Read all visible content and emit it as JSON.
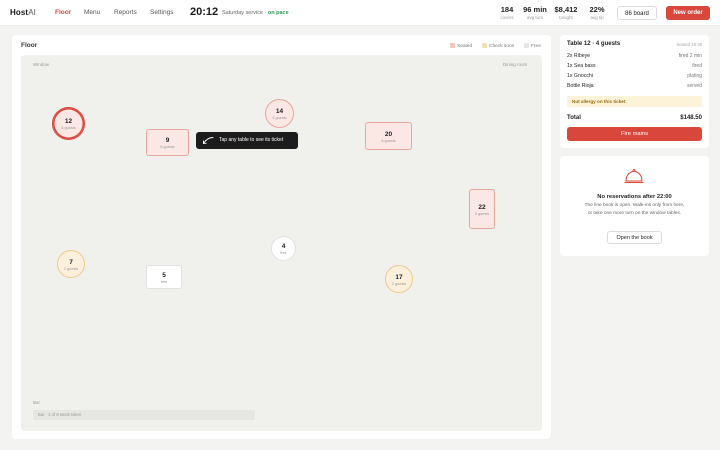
{
  "app": {
    "logo_main": "Host",
    "logo_suffix": "AI"
  },
  "nav": [
    {
      "label": "Floor",
      "active": true
    },
    {
      "label": "Menu",
      "active": false
    },
    {
      "label": "Reports",
      "active": false
    },
    {
      "label": "Settings",
      "active": false
    }
  ],
  "clock": "20:12",
  "service": {
    "label": "Saturday service · ",
    "status": "on pace"
  },
  "stats": [
    {
      "value": "184",
      "label": "covers"
    },
    {
      "value": "96 min",
      "label": "avg turn"
    },
    {
      "value": "$8,412",
      "label": "tonight"
    },
    {
      "value": "22%",
      "label": "avg tip"
    }
  ],
  "buttons": {
    "board": "86 board",
    "new_order": "New order"
  },
  "floor": {
    "title": "Floor",
    "legend": [
      {
        "label": "Seated",
        "color": "#f3c7bf"
      },
      {
        "label": "Check soon",
        "color": "#f4dfb6"
      },
      {
        "label": "Free",
        "color": "#e6e6e6"
      }
    ],
    "zones": {
      "window": "Window",
      "dining": "Dining room",
      "bar": "Bar"
    },
    "bar_status": "Bar · 3 of 8 seats taken",
    "tooltip": "Tap any table to see its ticket",
    "tables": [
      {
        "num": "12",
        "sub": "4 guests",
        "status": "seated",
        "shape": "round",
        "selected": true
      },
      {
        "num": "14",
        "sub": "4 guests",
        "status": "seated",
        "shape": "round"
      },
      {
        "num": "9",
        "sub": "6 guests",
        "status": "seated",
        "shape": "rect"
      },
      {
        "num": "20",
        "sub": "8 guests",
        "status": "seated",
        "shape": "rect"
      },
      {
        "num": "22",
        "sub": "5 guests",
        "status": "seated",
        "shape": "rect"
      },
      {
        "num": "4",
        "sub": "free",
        "status": "free",
        "shape": "round"
      },
      {
        "num": "7",
        "sub": "2 guests",
        "status": "soon",
        "shape": "round"
      },
      {
        "num": "5",
        "sub": "free",
        "status": "free",
        "shape": "rect"
      },
      {
        "num": "17",
        "sub": "2 guests",
        "status": "soon",
        "shape": "round"
      }
    ]
  },
  "ticket": {
    "title": "Table 12 · 4 guests",
    "seated": "Seated 19:36",
    "items": [
      {
        "name": "2x Ribeye",
        "status": "fired 2 min"
      },
      {
        "name": "1x Sea bass",
        "status": "fired"
      },
      {
        "name": "1x Gnocchi",
        "status": "plating"
      },
      {
        "name": "Bottle Rioja",
        "status": "served"
      }
    ],
    "allergy": "Nut allergy on this ticket",
    "total_label": "Total",
    "total_value": "$148.50",
    "fire_label": "Fire mains"
  },
  "reservations": {
    "icon": "cloche-icon",
    "title": "No reservations after 22:00",
    "body": "The line book is open. Walk-ins only from here, or take one more turn on the window tables.",
    "button": "Open the book"
  }
}
